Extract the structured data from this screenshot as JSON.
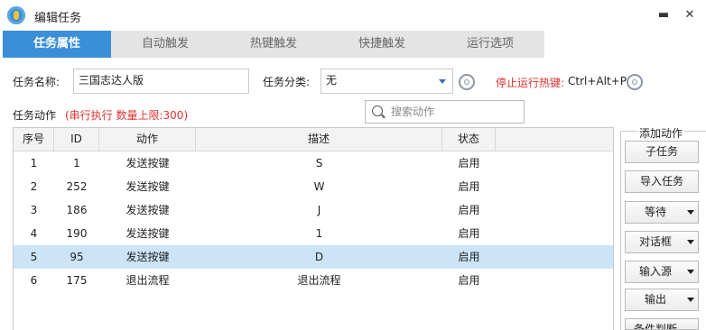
{
  "window": {
    "title": "编辑任务",
    "minimize_glyph": "▬",
    "close_glyph": "✕"
  },
  "tabs": [
    {
      "label": "任务属性",
      "active": true
    },
    {
      "label": "自动触发",
      "active": false
    },
    {
      "label": "热键触发",
      "active": false
    },
    {
      "label": "快捷触发",
      "active": false
    },
    {
      "label": "运行选项",
      "active": false
    }
  ],
  "form": {
    "name_label": "任务名称:",
    "name_value": "三国志达人版",
    "category_label": "任务分类:",
    "category_value": "无",
    "hotkey_label": "停止运行热键:",
    "hotkey_value": "Ctrl+Alt+P"
  },
  "actions": {
    "label": "任务动作",
    "info": "(串行执行 数量上限:300)",
    "search_placeholder": "搜索动作"
  },
  "table": {
    "headers": [
      "序号",
      "ID",
      "动作",
      "描述",
      "状态"
    ],
    "rows": [
      {
        "seq": "1",
        "id": "1",
        "action": "发送按键",
        "desc": "S",
        "status": "启用",
        "selected": false
      },
      {
        "seq": "2",
        "id": "252",
        "action": "发送按键",
        "desc": "W",
        "status": "启用",
        "selected": false
      },
      {
        "seq": "3",
        "id": "186",
        "action": "发送按键",
        "desc": "J",
        "status": "启用",
        "selected": false
      },
      {
        "seq": "4",
        "id": "190",
        "action": "发送按键",
        "desc": "1",
        "status": "启用",
        "selected": false
      },
      {
        "seq": "5",
        "id": "95",
        "action": "发送按键",
        "desc": "D",
        "status": "启用",
        "selected": true
      },
      {
        "seq": "6",
        "id": "175",
        "action": "退出流程",
        "desc": "退出流程",
        "status": "启用",
        "selected": false
      }
    ]
  },
  "add_panel": {
    "title": "添加动作",
    "buttons": [
      {
        "label": "子任务",
        "dropdown": false
      },
      {
        "label": "导入任务",
        "dropdown": false
      },
      {
        "label": "等待",
        "dropdown": true
      },
      {
        "label": "对话框",
        "dropdown": true
      },
      {
        "label": "输入源",
        "dropdown": true
      },
      {
        "label": "输出",
        "dropdown": true
      },
      {
        "label": "条件判断",
        "dropdown": true
      }
    ]
  },
  "colors": {
    "accent": "#3b8fd9",
    "selected_row": "#cce4f7",
    "warning": "#e03030"
  }
}
